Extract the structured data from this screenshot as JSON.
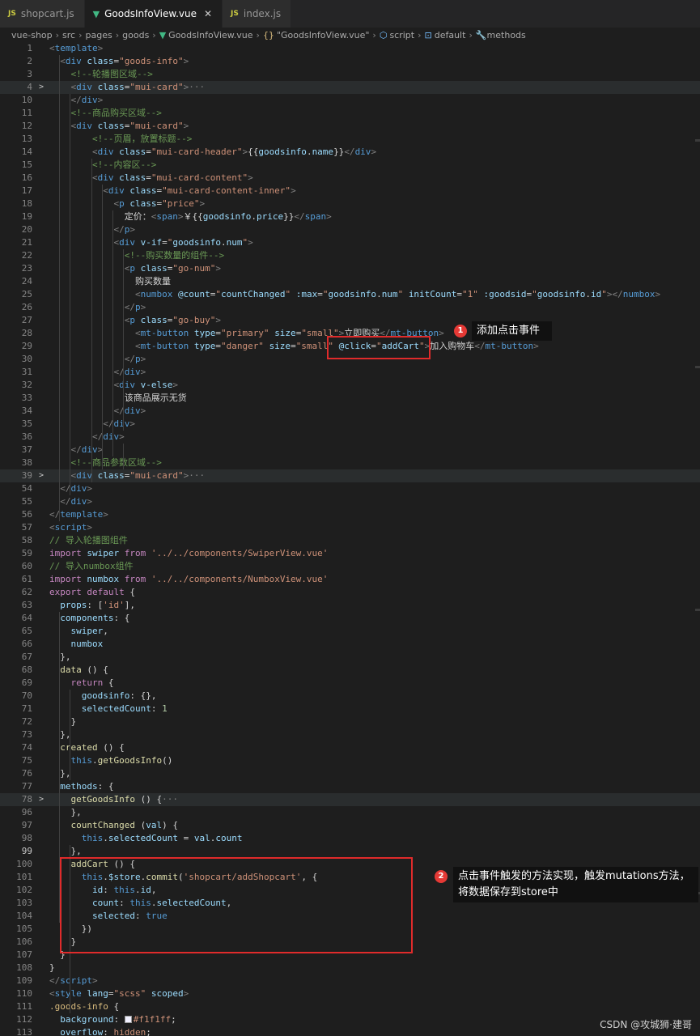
{
  "tabs": [
    {
      "icon": "JS",
      "label": "shopcart.js",
      "active": false
    },
    {
      "icon": "vue",
      "label": "GoodsInfoView.vue",
      "active": true,
      "close": "✕"
    },
    {
      "icon": "JS",
      "label": "index.js",
      "active": false
    }
  ],
  "breadcrumb": {
    "parts": [
      "vue-shop",
      "src",
      "pages",
      "goods"
    ],
    "file": "GoodsInfoView.vue",
    "obj": "\"GoodsInfoView.vue\"",
    "script": "script",
    "def": "default",
    "methods": "methods",
    "obj_icon": "{}"
  },
  "code": [
    {
      "n": "1",
      "h": "<span class=t>&lt;</span><span class=g>template</span><span class=t>&gt;</span>"
    },
    {
      "n": "2",
      "h": "  <span class=t>&lt;</span><span class=g>div</span> <span class=a>class</span>=<span class=s>\"goods-info\"</span><span class=t>&gt;</span>"
    },
    {
      "n": "3",
      "h": "    <span class=c>&lt;!--轮播图区域--&gt;</span>"
    },
    {
      "n": "4",
      "fold": ">",
      "h": "    <span class=t>&lt;</span><span class=g>div</span> <span class=a>class</span>=<span class=s>\"mui-card\"</span><span class=t>&gt;</span><span class=t>···</span>",
      "hl": true
    },
    {
      "n": "10",
      "h": "    <span class=t>&lt;/</span><span class=g>div</span><span class=t>&gt;</span>"
    },
    {
      "n": "11",
      "h": "    <span class=c>&lt;!--商品购买区域--&gt;</span>"
    },
    {
      "n": "12",
      "h": "    <span class=t>&lt;</span><span class=g>div</span> <span class=a>class</span>=<span class=s>\"mui-card\"</span><span class=t>&gt;</span>"
    },
    {
      "n": "13",
      "h": "        <span class=c>&lt;!--页眉，放置标题--&gt;</span>"
    },
    {
      "n": "14",
      "h": "        <span class=t>&lt;</span><span class=g>div</span> <span class=a>class</span>=<span class=s>\"mui-card-header\"</span><span class=t>&gt;</span>{{<span class=a>goodsinfo</span>.<span class=a>name</span>}}<span class=t>&lt;/</span><span class=g>div</span><span class=t>&gt;</span>"
    },
    {
      "n": "15",
      "h": "        <span class=c>&lt;!--内容区--&gt;</span>"
    },
    {
      "n": "16",
      "h": "        <span class=t>&lt;</span><span class=g>div</span> <span class=a>class</span>=<span class=s>\"mui-card-content\"</span><span class=t>&gt;</span>"
    },
    {
      "n": "17",
      "h": "          <span class=t>&lt;</span><span class=g>div</span> <span class=a>class</span>=<span class=s>\"mui-card-content-inner\"</span><span class=t>&gt;</span>"
    },
    {
      "n": "18",
      "h": "            <span class=t>&lt;</span><span class=g>p</span> <span class=a>class</span>=<span class=s>\"price\"</span><span class=t>&gt;</span>"
    },
    {
      "n": "19",
      "h": "              定价：<span class=t>&lt;</span><span class=g>span</span><span class=t>&gt;</span>￥{{<span class=a>goodsinfo</span>.<span class=a>price</span>}}<span class=t>&lt;/</span><span class=g>span</span><span class=t>&gt;</span>"
    },
    {
      "n": "20",
      "h": "            <span class=t>&lt;/</span><span class=g>p</span><span class=t>&gt;</span>"
    },
    {
      "n": "21",
      "h": "            <span class=t>&lt;</span><span class=g>div</span> <span class=a>v-if</span>=<span class=s>\"</span><span class=a>goodsinfo</span>.<span class=a>num</span><span class=s>\"</span><span class=t>&gt;</span>"
    },
    {
      "n": "22",
      "h": "              <span class=c>&lt;!--购买数量的组件--&gt;</span>"
    },
    {
      "n": "23",
      "h": "              <span class=t>&lt;</span><span class=g>p</span> <span class=a>class</span>=<span class=s>\"go-num\"</span><span class=t>&gt;</span>"
    },
    {
      "n": "24",
      "h": "                购买数量"
    },
    {
      "n": "25",
      "h": "                <span class=t>&lt;</span><span class=g>numbox</span> <span class=a>@count</span>=<span class=s>\"</span><span class=a>countChanged</span><span class=s>\"</span> <span class=a>:max</span>=<span class=s>\"</span><span class=a>goodsinfo</span>.<span class=a>num</span><span class=s>\"</span> <span class=a>initCount</span>=<span class=s>\"1\"</span> <span class=a>:goodsid</span>=<span class=s>\"</span><span class=a>goodsinfo</span>.<span class=a>id</span><span class=s>\"</span><span class=t>&gt;&lt;/</span><span class=g>numbox</span><span class=t>&gt;</span>"
    },
    {
      "n": "26",
      "h": "              <span class=t>&lt;/</span><span class=g>p</span><span class=t>&gt;</span>"
    },
    {
      "n": "27",
      "h": "              <span class=t>&lt;</span><span class=g>p</span> <span class=a>class</span>=<span class=s>\"go-buy\"</span><span class=t>&gt;</span>"
    },
    {
      "n": "28",
      "h": "                <span class=t>&lt;</span><span class=g>mt-button</span> <span class=a>type</span>=<span class=s>\"primary\"</span> <span class=a>size</span>=<span class=s>\"small\"</span><span class=t>&gt;</span>立即购买<span class=t>&lt;/</span><span class=g>mt-button</span><span class=t>&gt;</span>"
    },
    {
      "n": "29",
      "h": "                <span class=t>&lt;</span><span class=g>mt-button</span> <span class=a>type</span>=<span class=s>\"danger\"</span> <span class=a>size</span>=<span class=s>\"small\"</span> <span class=a>@click</span>=<span class=s>\"</span><span class=a>addCart</span><span class=s>\"</span><span class=t>&gt;</span>加入购物车<span class=t>&lt;/</span><span class=g>mt-button</span><span class=t>&gt;</span>"
    },
    {
      "n": "30",
      "h": "              <span class=t>&lt;/</span><span class=g>p</span><span class=t>&gt;</span>"
    },
    {
      "n": "31",
      "h": "            <span class=t>&lt;/</span><span class=g>div</span><span class=t>&gt;</span>"
    },
    {
      "n": "32",
      "h": "            <span class=t>&lt;</span><span class=g>div</span> <span class=a>v-else</span><span class=t>&gt;</span>"
    },
    {
      "n": "33",
      "h": "              该商品展示无货"
    },
    {
      "n": "34",
      "h": "            <span class=t>&lt;/</span><span class=g>div</span><span class=t>&gt;</span>"
    },
    {
      "n": "35",
      "h": "          <span class=t>&lt;/</span><span class=g>div</span><span class=t>&gt;</span>"
    },
    {
      "n": "36",
      "h": "        <span class=t>&lt;/</span><span class=g>div</span><span class=t>&gt;</span>"
    },
    {
      "n": "37",
      "h": "    <span class=t>&lt;/</span><span class=g>div</span><span class=t>&gt;</span>"
    },
    {
      "n": "38",
      "h": "    <span class=c>&lt;!--商品参数区域--&gt;</span>"
    },
    {
      "n": "39",
      "fold": ">",
      "h": "    <span class=t>&lt;</span><span class=g>div</span> <span class=a>class</span>=<span class=s>\"mui-card\"</span><span class=t>&gt;</span><span class=t>···</span>",
      "hl": true
    },
    {
      "n": "54",
      "h": "  <span class=t>&lt;/</span><span class=g>div</span><span class=t>&gt;</span>"
    },
    {
      "n": "55",
      "h": "  <span class=t>&lt;/</span><span class=g>div</span><span class=t>&gt;</span>"
    },
    {
      "n": "56",
      "h": "<span class=t>&lt;/</span><span class=g>template</span><span class=t>&gt;</span>"
    },
    {
      "n": "57",
      "h": "<span class=t>&lt;</span><span class=g>script</span><span class=t>&gt;</span>"
    },
    {
      "n": "58",
      "h": "<span class=c>// 导入轮播图组件</span>"
    },
    {
      "n": "59",
      "h": "<span class=k>import</span> <span class=a>swiper</span> <span class=k>from</span> <span class=s>'../../components/SwiperView.vue'</span>"
    },
    {
      "n": "60",
      "h": "<span class=c>// 导入numbox组件</span>"
    },
    {
      "n": "61",
      "h": "<span class=k>import</span> <span class=a>numbox</span> <span class=k>from</span> <span class=s>'../../components/NumboxView.vue'</span>"
    },
    {
      "n": "62",
      "h": "<span class=k>export</span> <span class=k>default</span> {"
    },
    {
      "n": "63",
      "h": "  <span class=a>props</span>: [<span class=s>'id'</span>],"
    },
    {
      "n": "64",
      "h": "  <span class=a>components</span>: {"
    },
    {
      "n": "65",
      "h": "    <span class=a>swiper</span>,"
    },
    {
      "n": "66",
      "h": "    <span class=a>numbox</span>"
    },
    {
      "n": "67",
      "h": "  },"
    },
    {
      "n": "68",
      "h": "  <span class=f>data</span> () {"
    },
    {
      "n": "69",
      "h": "    <span class=k>return</span> {"
    },
    {
      "n": "70",
      "h": "      <span class=a>goodsinfo</span>: {},"
    },
    {
      "n": "71",
      "h": "      <span class=a>selectedCount</span>: <span class=n>1</span>"
    },
    {
      "n": "72",
      "h": "    }"
    },
    {
      "n": "73",
      "h": "  },"
    },
    {
      "n": "74",
      "h": "  <span class=f>created</span> () {"
    },
    {
      "n": "75",
      "h": "    <span class=g>this</span>.<span class=f>getGoodsInfo</span>()"
    },
    {
      "n": "76",
      "h": "  },"
    },
    {
      "n": "77",
      "h": "  <span class=a>methods</span>: {"
    },
    {
      "n": "78",
      "fold": ">",
      "h": "    <span class=f>getGoodsInfo</span> () {<span class=t>···</span>",
      "hl": true
    },
    {
      "n": "96",
      "h": "    },"
    },
    {
      "n": "97",
      "h": "    <span class=f>countChanged</span> (<span class=a>val</span>) {"
    },
    {
      "n": "98",
      "h": "      <span class=g>this</span>.<span class=a>selectedCount</span> = <span class=a>val</span>.<span class=a>count</span>"
    },
    {
      "n": "99",
      "cur": true,
      "h": "    },"
    },
    {
      "n": "100",
      "h": "    <span class=f>addCart</span> () {"
    },
    {
      "n": "101",
      "h": "      <span class=g>this</span>.<span class=a>$store</span>.<span class=f>commit</span>(<span class=s>'shopcart/addShopcart'</span>, {"
    },
    {
      "n": "102",
      "h": "        <span class=a>id</span>: <span class=g>this</span>.<span class=a>id</span>,"
    },
    {
      "n": "103",
      "h": "        <span class=a>count</span>: <span class=g>this</span>.<span class=a>selectedCount</span>,"
    },
    {
      "n": "104",
      "h": "        <span class=a>selected</span>: <span class=g>true</span>"
    },
    {
      "n": "105",
      "h": "      })"
    },
    {
      "n": "106",
      "h": "    }"
    },
    {
      "n": "107",
      "h": "  }"
    },
    {
      "n": "108",
      "h": "}"
    },
    {
      "n": "109",
      "h": "<span class=t>&lt;/</span><span class=g>script</span><span class=t>&gt;</span>"
    },
    {
      "n": "110",
      "h": "<span class=t>&lt;</span><span class=g>style</span> <span class=a>lang</span>=<span class=s>\"scss\"</span> <span class=a>scoped</span><span class=t>&gt;</span>"
    },
    {
      "n": "111",
      "h": "<span class=cl>.goods-info</span> {"
    },
    {
      "n": "112",
      "h": "  <span class=a>background</span>: <i class=swatch></i><span class=s>#f1f1ff</span>;"
    },
    {
      "n": "113",
      "h": "  <span class=a>overflow</span>: <span class=s>hidden</span>;"
    }
  ],
  "annotations": [
    {
      "num": "1",
      "text": "添加点击事件"
    },
    {
      "num": "2",
      "text": "点击事件触发的方法实现，触发mutations方法，将数据保存到store中"
    }
  ],
  "watermark": "CSDN @攻城狮·建哥",
  "colors": {
    "editor_bg": "#1e1e1e",
    "tag": "#569cd6",
    "attr": "#9cdcfe",
    "string": "#ce9178",
    "comment": "#6a9955",
    "keyword": "#c586c0",
    "highlight_box": "#e02b2b"
  }
}
